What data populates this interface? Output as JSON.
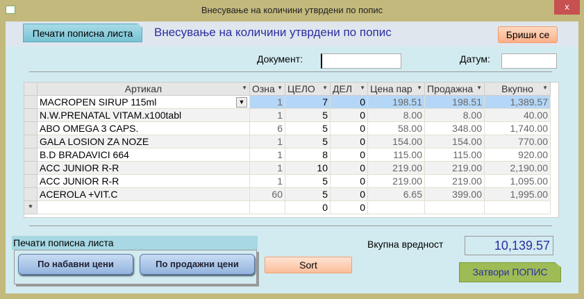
{
  "window": {
    "title": "Внесување на количини утврдени по попис",
    "close": "x"
  },
  "header": {
    "print_button": "Печати пописна листа",
    "heading": "Внесување на количини утврдени по попис",
    "delete_all": "Бриши се"
  },
  "filters": {
    "document_label": "Документ:",
    "document_value": "",
    "date_label": "Датум:",
    "date_value": ""
  },
  "table": {
    "columns": [
      "Артикал",
      "Озна",
      "ЦЕЛО",
      "ДЕЛ",
      "Цена пар",
      "Продажна",
      "Вкупно"
    ],
    "rows": [
      [
        "MACROPEN SIRUP 115ml",
        "1",
        "7",
        "0",
        "198.51",
        "198.51",
        "1,389.57"
      ],
      [
        "N.W.PRENATAL VITAM.x100tabl",
        "1",
        "5",
        "0",
        "8.00",
        "8.00",
        "40.00"
      ],
      [
        "ABO OMEGA 3 CAPS.",
        "6",
        "5",
        "0",
        "58.00",
        "348.00",
        "1,740.00"
      ],
      [
        "GALA LOSION ZA NOZE",
        "1",
        "5",
        "0",
        "154.00",
        "154.00",
        "770.00"
      ],
      [
        "B.D BRADAVICI 664",
        "1",
        "8",
        "0",
        "115.00",
        "115.00",
        "920.00"
      ],
      [
        "ACC JUNIOR R-R",
        "1",
        "10",
        "0",
        "219.00",
        "219.00",
        "2,190.00"
      ],
      [
        "ACC JUNIOR R-R",
        "1",
        "5",
        "0",
        "219.00",
        "219.00",
        "1,095.00"
      ],
      [
        "ACEROLA +VIT.C",
        "60",
        "5",
        "0",
        "6.65",
        "399.00",
        "1,995.00"
      ]
    ],
    "new_row": {
      "marker": "*",
      "whole": "0",
      "part": "0"
    }
  },
  "print_group": {
    "title": "Печати пописна листа",
    "by_purchase": "По набавни цени",
    "by_sale": "По продажни цени"
  },
  "sort_button": "Sort",
  "total": {
    "label": "Вкупна вредност",
    "value": "10,139.57"
  },
  "close_button": "Затвори ПОПИС"
}
